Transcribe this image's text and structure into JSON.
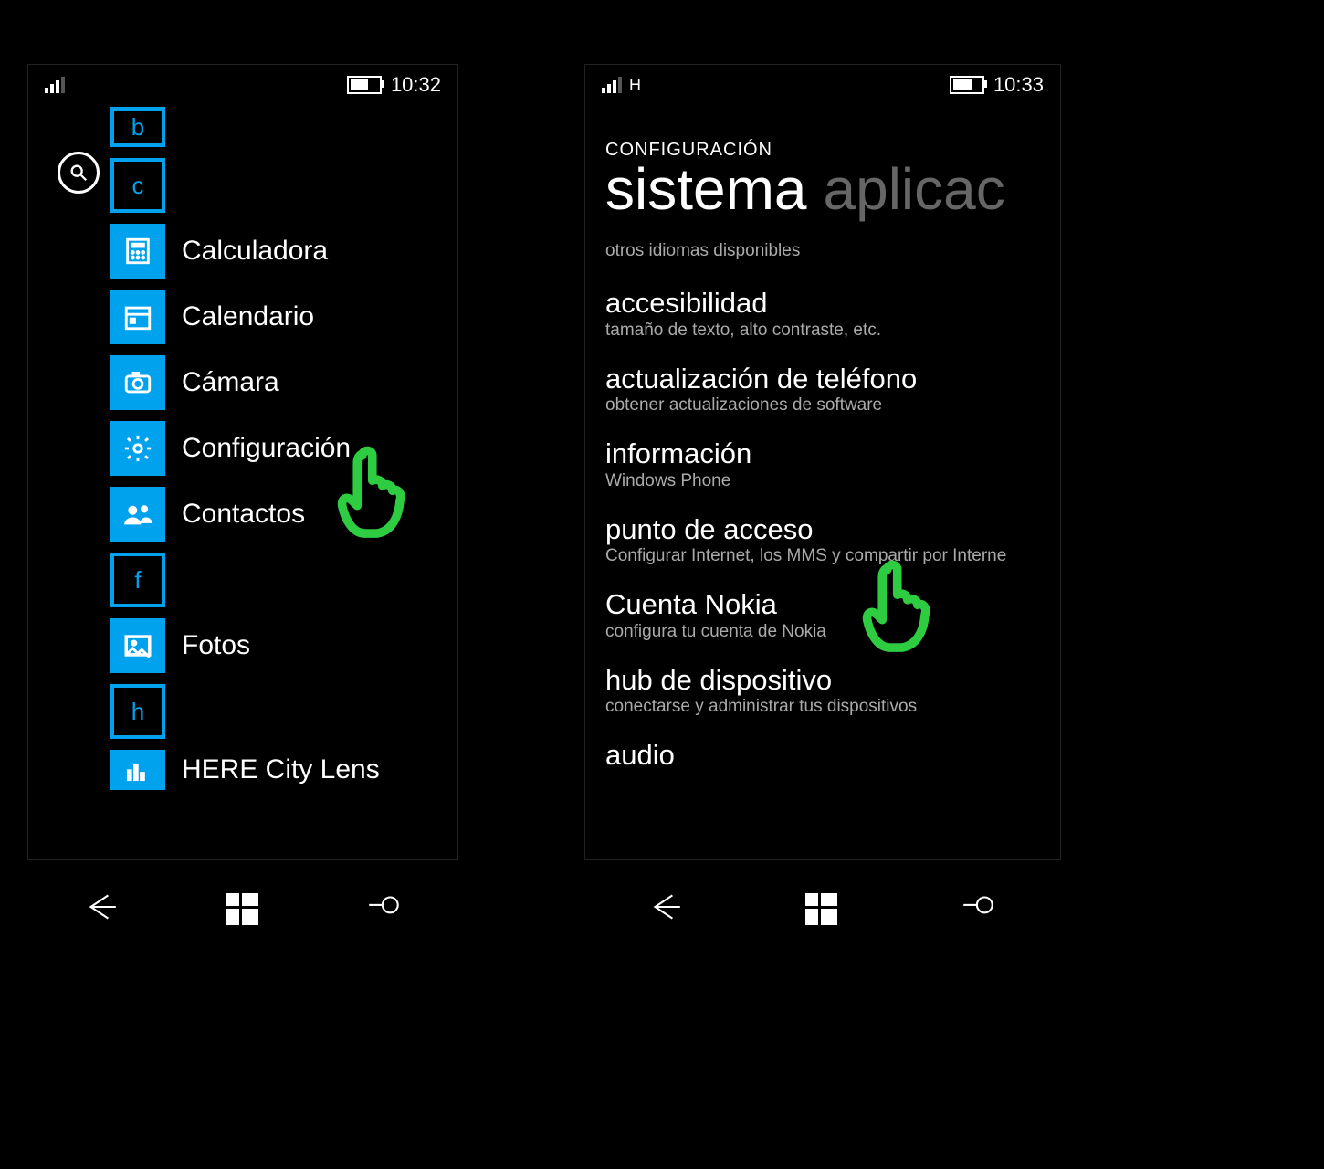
{
  "left": {
    "status": {
      "network": "",
      "time": "10:32",
      "charging": true
    },
    "jump_letters": [
      "b",
      "c",
      "f",
      "h"
    ],
    "apps": [
      {
        "icon": "calculator-icon",
        "label": "Calculadora"
      },
      {
        "icon": "calendar-icon",
        "label": "Calendario"
      },
      {
        "icon": "camera-icon",
        "label": "Cámara"
      },
      {
        "icon": "settings-icon",
        "label": "Configuración"
      },
      {
        "icon": "contacts-icon",
        "label": "Contactos"
      },
      {
        "icon": "photos-icon",
        "label": "Fotos"
      },
      {
        "icon": "citylens-icon",
        "label": "HERE City Lens"
      }
    ]
  },
  "right": {
    "status": {
      "network": "H",
      "time": "10:33",
      "charging": false
    },
    "header_overline": "CONFIGURACIÓN",
    "pivot_active": "sistema",
    "pivot_inactive": "aplicac",
    "top_note": "otros idiomas disponibles",
    "items": [
      {
        "title": "accesibilidad",
        "sub": "tamaño de texto, alto contraste, etc."
      },
      {
        "title": "actualización de teléfono",
        "sub": "obtener actualizaciones de software"
      },
      {
        "title": "información",
        "sub": "Windows Phone"
      },
      {
        "title": "punto de acceso",
        "sub": "Configurar Internet, los MMS y compartir por Interne"
      },
      {
        "title": "Cuenta Nokia",
        "sub": "configura tu cuenta de Nokia"
      },
      {
        "title": "hub de dispositivo",
        "sub": "conectarse y administrar tus dispositivos"
      },
      {
        "title": "audio",
        "sub": ""
      }
    ]
  },
  "hand_color": "#2ecc40"
}
